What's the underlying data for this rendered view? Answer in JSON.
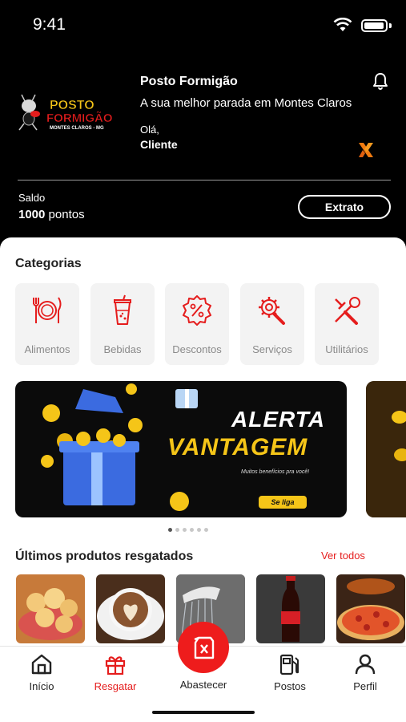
{
  "status": {
    "time": "9:41"
  },
  "header": {
    "store_name": "Posto Formigão",
    "tagline": "A sua melhor parada em Montes Claros",
    "greeting": "Olá,",
    "user": "Cliente",
    "logo": {
      "line1": "POSTO",
      "line2": "FORMIGÃO",
      "line3": "MONTES CLAROS - MG"
    },
    "balance_label": "Saldo",
    "balance_points": "1000",
    "balance_unit": "pontos",
    "extrato_label": "Extrato"
  },
  "categories": {
    "title": "Categorias",
    "items": [
      {
        "label": "Alimentos",
        "icon": "utensils-icon"
      },
      {
        "label": "Bebidas",
        "icon": "drink-cup-icon"
      },
      {
        "label": "Descontos",
        "icon": "discount-badge-icon"
      },
      {
        "label": "Serviços",
        "icon": "gear-wrench-icon"
      },
      {
        "label": "Utilitários",
        "icon": "tools-icon"
      }
    ]
  },
  "banner": {
    "title1": "ALERTA",
    "title2": "VANTAGEM",
    "subtitle": "Muitos benefícios pra você!",
    "button": "Se liga",
    "page_index": 1,
    "page_count": 6
  },
  "products": {
    "title": "Últimos produtos resgatados",
    "see_all": "Ver todos",
    "items": [
      "pão de queijo",
      "cappuccino",
      "chuveiro",
      "coca-cola",
      "pizza"
    ]
  },
  "tabbar": {
    "items": [
      {
        "label": "Início",
        "icon": "home-icon",
        "active": false
      },
      {
        "label": "Resgatar",
        "icon": "gift-icon",
        "active": true
      },
      {
        "label": "Abastecer",
        "icon": "fuel-can-icon",
        "active": false
      },
      {
        "label": "Postos",
        "icon": "fuel-pump-icon",
        "active": false
      },
      {
        "label": "Perfil",
        "icon": "user-icon",
        "active": false
      }
    ]
  },
  "colors": {
    "accent": "#e51d1d",
    "banner_yellow": "#f5c518",
    "header_bg": "#000000"
  }
}
